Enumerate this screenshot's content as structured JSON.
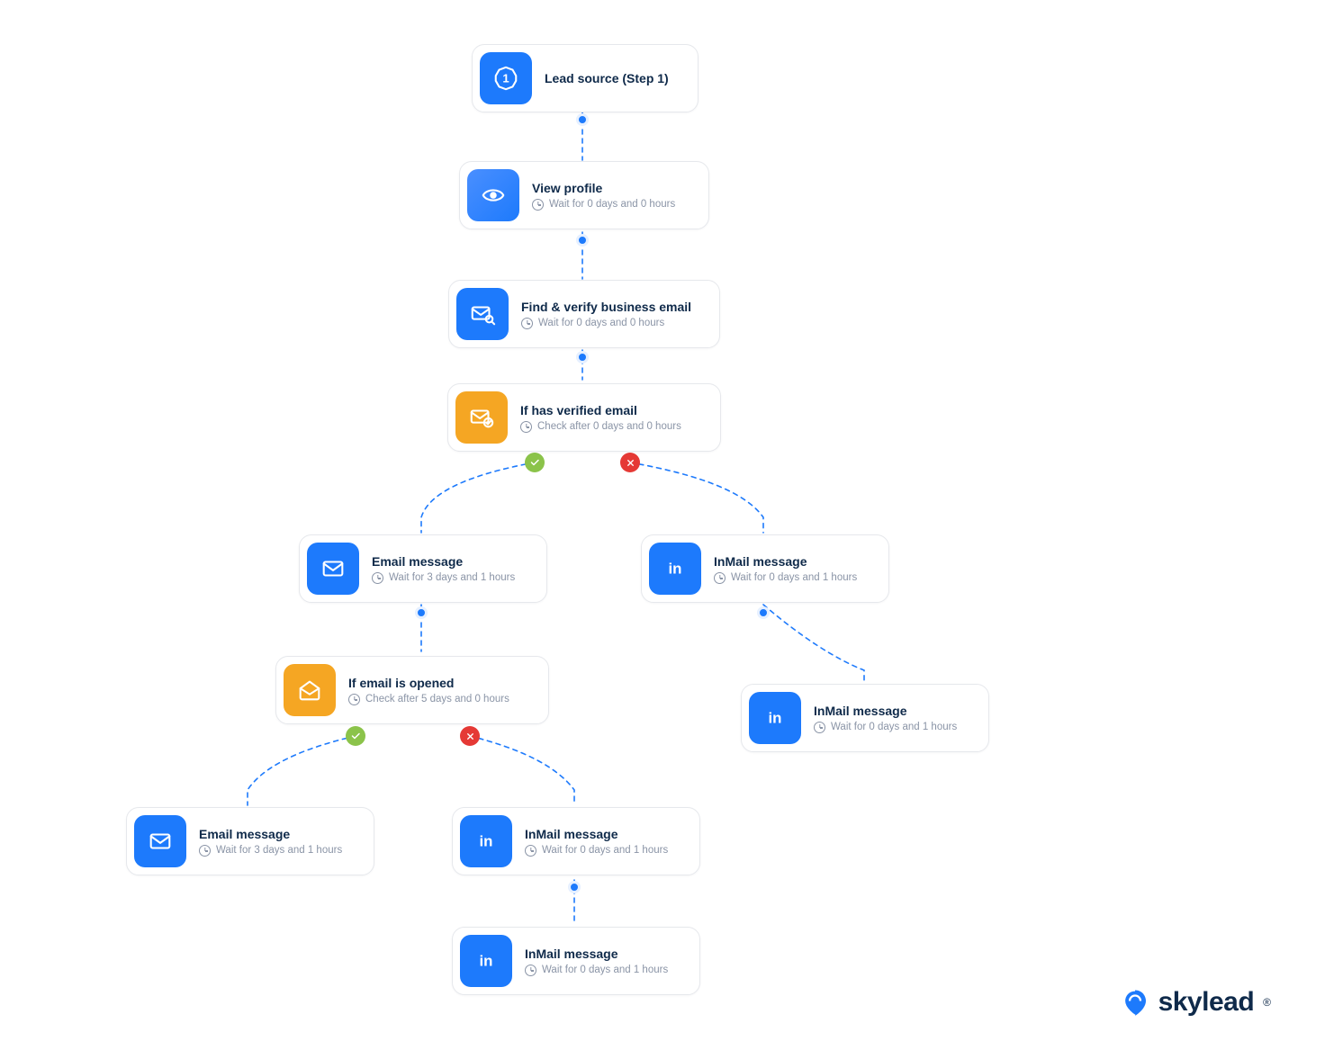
{
  "colors": {
    "primary": "#1D7AFC",
    "condition": "#F5A623",
    "yes": "#8BC34A",
    "no": "#E53935",
    "text": "#0F2A4A",
    "muted": "#8A94A6"
  },
  "brand": "skylead",
  "nodes": {
    "lead_source": {
      "title": "Lead source (Step 1)",
      "subtitle": ""
    },
    "view_profile": {
      "title": "View profile",
      "subtitle": "Wait for 0 days and 0 hours"
    },
    "find_verify": {
      "title": "Find & verify business email",
      "subtitle": "Wait for 0 days and 0 hours"
    },
    "if_verified": {
      "title": "If has verified email",
      "subtitle": "Check after 0 days and 0 hours"
    },
    "email_msg_1": {
      "title": "Email message",
      "subtitle": "Wait for 3 days and 1 hours"
    },
    "inmail_r1": {
      "title": "InMail message",
      "subtitle": "Wait for 0 days and 1 hours"
    },
    "if_opened": {
      "title": "If email is opened",
      "subtitle": "Check after 5 days and 0 hours"
    },
    "inmail_r2": {
      "title": "InMail message",
      "subtitle": "Wait for 0 days and 1 hours"
    },
    "email_msg_2": {
      "title": "Email message",
      "subtitle": "Wait for 3 days and 1 hours"
    },
    "inmail_m1": {
      "title": "InMail message",
      "subtitle": "Wait for 0 days and 1 hours"
    },
    "inmail_m2": {
      "title": "InMail message",
      "subtitle": "Wait for 0 days and 1 hours"
    }
  }
}
